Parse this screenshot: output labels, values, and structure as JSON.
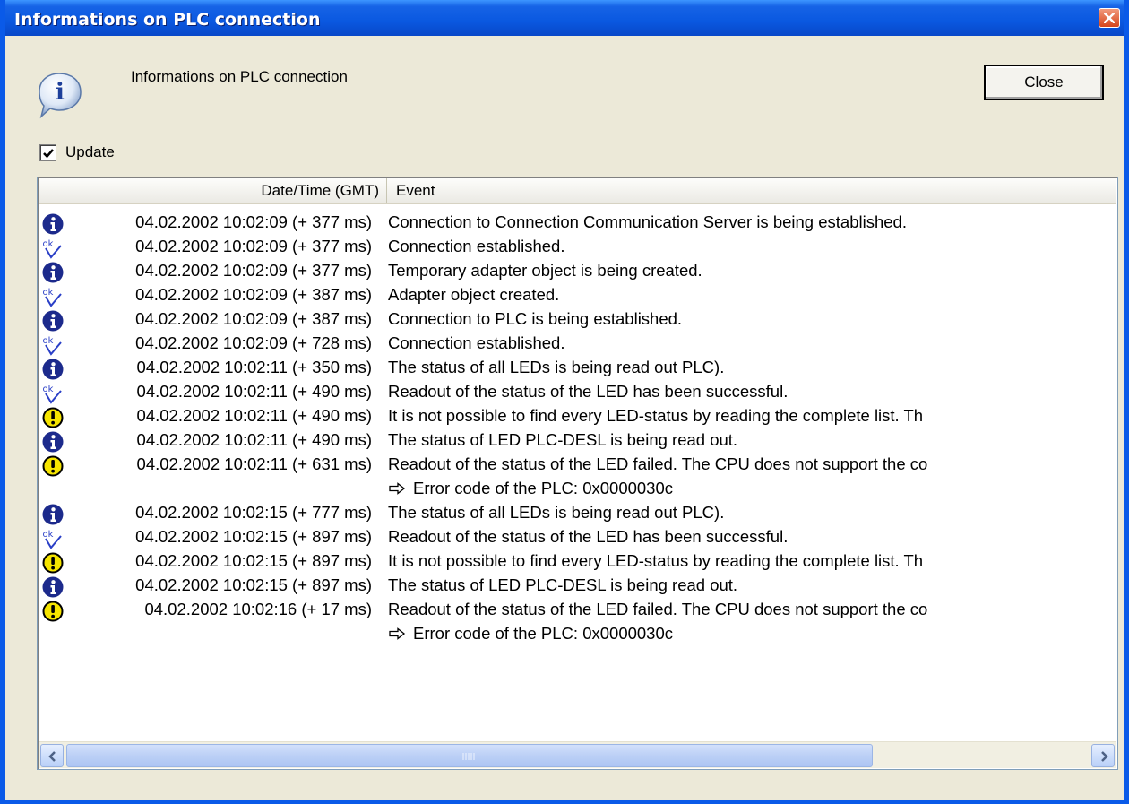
{
  "window": {
    "title": "Informations on PLC connection",
    "header_label": "Informations on PLC connection",
    "close_button_label": "Close"
  },
  "update": {
    "label": "Update",
    "checked": true
  },
  "log": {
    "columns": [
      "Date/Time (GMT)",
      "Event"
    ],
    "rows": [
      {
        "icon": "info-icon",
        "datetime": "04.02.2002 10:02:09 (+ 377 ms)",
        "event": "Connection to Connection Communication Server is being established."
      },
      {
        "icon": "ok-icon",
        "datetime": "04.02.2002 10:02:09 (+ 377 ms)",
        "event": "Connection established."
      },
      {
        "icon": "info-icon",
        "datetime": "04.02.2002 10:02:09 (+ 377 ms)",
        "event": "Temporary adapter object is being created."
      },
      {
        "icon": "ok-icon",
        "datetime": "04.02.2002 10:02:09 (+ 387 ms)",
        "event": "Adapter object created."
      },
      {
        "icon": "info-icon",
        "datetime": "04.02.2002 10:02:09 (+ 387 ms)",
        "event": "Connection to PLC is being established."
      },
      {
        "icon": "ok-icon",
        "datetime": "04.02.2002 10:02:09 (+ 728 ms)",
        "event": "Connection established."
      },
      {
        "icon": "info-icon",
        "datetime": "04.02.2002 10:02:11 (+ 350 ms)",
        "event": "The status of all LEDs is being read out PLC)."
      },
      {
        "icon": "ok-icon",
        "datetime": "04.02.2002 10:02:11 (+ 490 ms)",
        "event": "Readout of the status of the LED has been successful."
      },
      {
        "icon": "warning-icon",
        "datetime": "04.02.2002 10:02:11 (+ 490 ms)",
        "event": "It is not possible to find every LED-status by reading the complete list. Th"
      },
      {
        "icon": "info-icon",
        "datetime": "04.02.2002 10:02:11 (+ 490 ms)",
        "event": "The status of LED PLC-DESL is being read out."
      },
      {
        "icon": "warning-icon",
        "datetime": "04.02.2002 10:02:11 (+ 631 ms)",
        "event": "Readout of the status of the LED failed. The CPU does not support the co"
      },
      {
        "icon": "",
        "datetime": "",
        "event": "Error code of the PLC: 0x0000030c",
        "continuation": true
      },
      {
        "icon": "info-icon",
        "datetime": "04.02.2002 10:02:15 (+ 777 ms)",
        "event": "The status of all LEDs is being read out PLC)."
      },
      {
        "icon": "ok-icon",
        "datetime": "04.02.2002 10:02:15 (+ 897 ms)",
        "event": "Readout of the status of the LED has been successful."
      },
      {
        "icon": "warning-icon",
        "datetime": "04.02.2002 10:02:15 (+ 897 ms)",
        "event": "It is not possible to find every LED-status by reading the complete list. Th"
      },
      {
        "icon": "info-icon",
        "datetime": "04.02.2002 10:02:15 (+ 897 ms)",
        "event": "The status of LED PLC-DESL is being read out."
      },
      {
        "icon": "warning-icon",
        "datetime": "04.02.2002 10:02:16 (+ 17 ms)",
        "event": "Readout of the status of the LED failed. The CPU does not support the co"
      },
      {
        "icon": "",
        "datetime": "",
        "event": "Error code of the PLC: 0x0000030c",
        "continuation": true
      }
    ]
  },
  "colors": {
    "title_bar": "#0a58e0",
    "info_icon": "#1c2a8c",
    "ok_icon": "#2a3fc7",
    "warning_icon": "#f5e400"
  }
}
